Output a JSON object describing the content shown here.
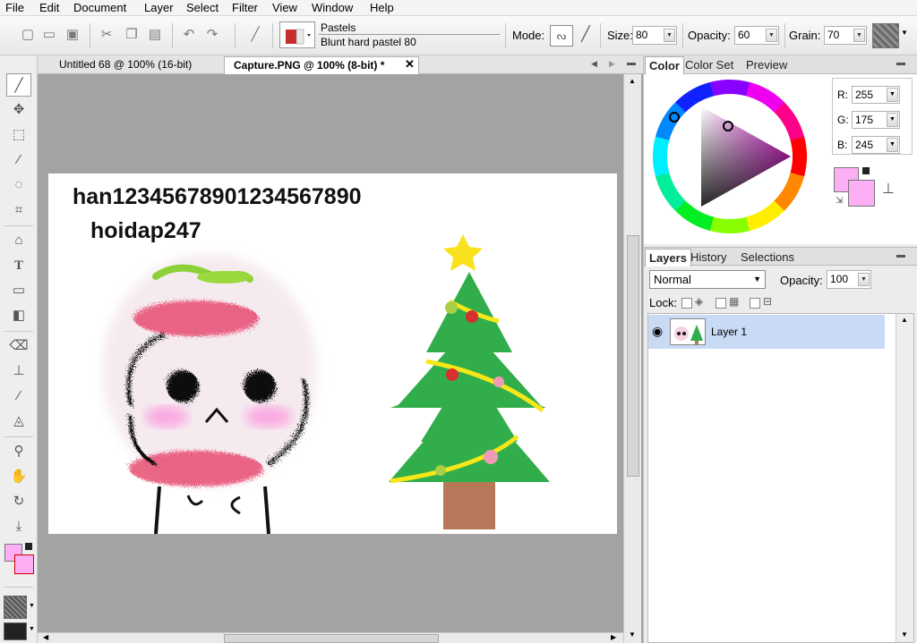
{
  "menu": [
    "File",
    "Edit",
    "Document",
    "Layer",
    "Select",
    "Filter",
    "View",
    "Window",
    "Help"
  ],
  "brush": {
    "category": "Pastels",
    "variant": "Blunt hard pastel 80"
  },
  "options": {
    "mode_label": "Mode:",
    "size_label": "Size:",
    "size_value": "80",
    "opacity_label": "Opacity:",
    "opacity_value": "60",
    "grain_label": "Grain:",
    "grain_value": "70"
  },
  "doc_tabs": [
    {
      "label": "Untitled 68 @ 100% (16-bit)"
    },
    {
      "label": "Capture.PNG @ 100% (8-bit) *"
    }
  ],
  "canvas_text": {
    "line1": "han12345678901234567890",
    "line2": "hoidap247"
  },
  "color_panel": {
    "tabs": [
      "Color",
      "Color Set",
      "Preview"
    ],
    "r_label": "R:",
    "r": "255",
    "g_label": "G:",
    "g": "175",
    "b_label": "B:",
    "b": "245",
    "foreground": "#fcaff5",
    "background": "#ffffff"
  },
  "layers_panel": {
    "tabs": [
      "Layers",
      "History",
      "Selections"
    ],
    "blend_mode": "Normal",
    "opacity_label": "Opacity:",
    "opacity": "100",
    "lock_label": "Lock:",
    "layers": [
      {
        "name": "Layer 1"
      }
    ]
  },
  "icons": {
    "new": "new-document-icon",
    "open": "open-icon",
    "save": "save-icon",
    "cut": "cut-icon",
    "copy": "copy-icon",
    "paste": "paste-icon",
    "undo": "undo-icon",
    "redo": "redo-icon"
  }
}
